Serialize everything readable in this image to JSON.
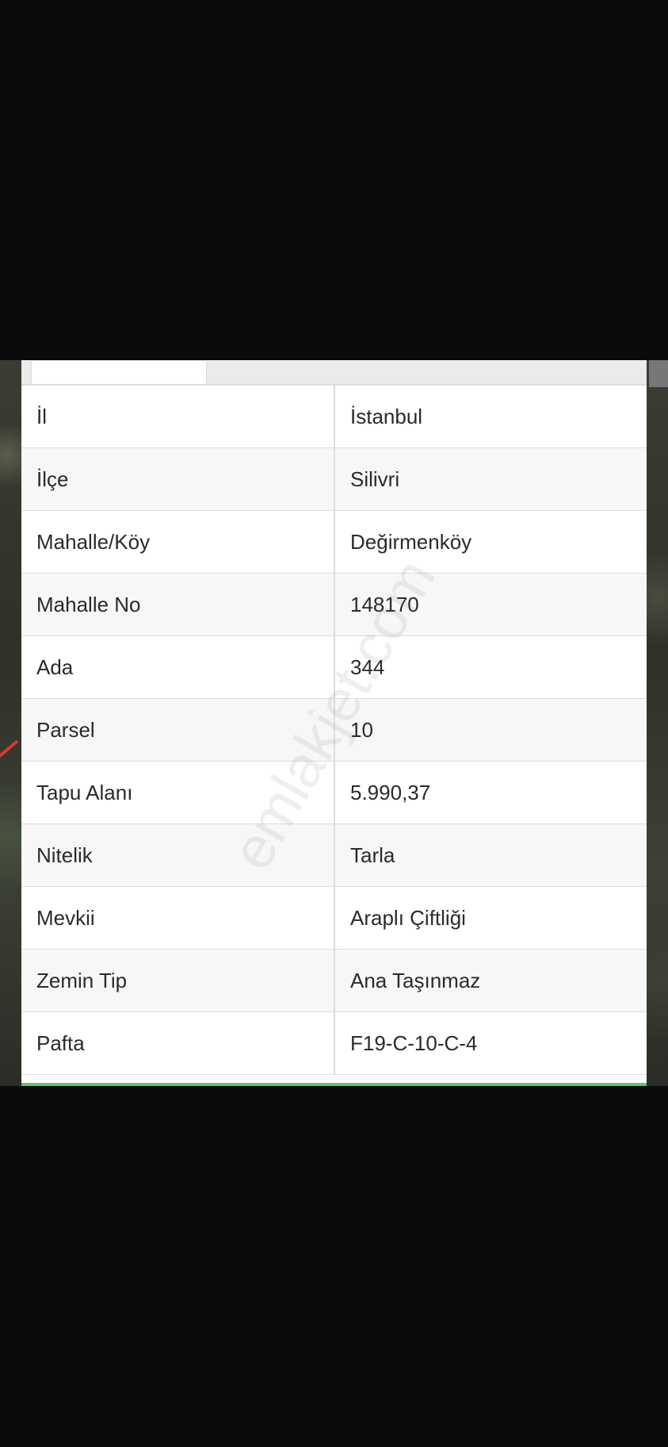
{
  "watermark": "emlakjet.com",
  "rows": [
    {
      "label": "İl",
      "value": "İstanbul"
    },
    {
      "label": "İlçe",
      "value": "Silivri"
    },
    {
      "label": "Mahalle/Köy",
      "value": "Değirmenköy"
    },
    {
      "label": "Mahalle No",
      "value": "148170"
    },
    {
      "label": "Ada",
      "value": "344"
    },
    {
      "label": "Parsel",
      "value": "10"
    },
    {
      "label": "Tapu Alanı",
      "value": "5.990,37"
    },
    {
      "label": "Nitelik",
      "value": "Tarla"
    },
    {
      "label": "Mevkii",
      "value": "Araplı Çiftliği"
    },
    {
      "label": "Zemin Tip",
      "value": "Ana Taşınmaz"
    },
    {
      "label": "Pafta",
      "value": "F19-C-10-C-4"
    }
  ],
  "colors": {
    "background": "#0b0b0c",
    "panel": "#ffffff",
    "zebra": "#f7f7f7",
    "accent_bottom": "#5cc36f",
    "map_road": "#d43a32"
  }
}
